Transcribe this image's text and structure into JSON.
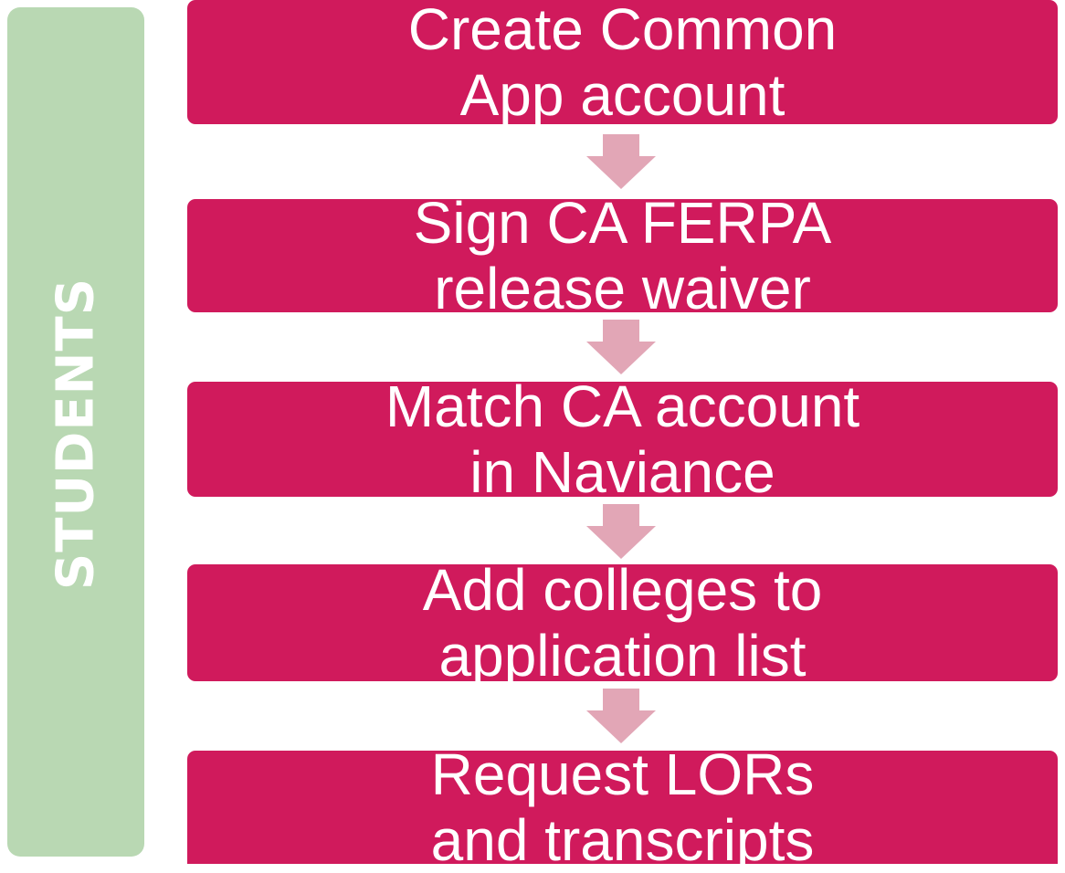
{
  "side_label": "STUDENTS",
  "steps": [
    "Create Common\nApp account",
    "Sign CA FERPA\nrelease waiver",
    "Match CA account\nin Naviance",
    "Add colleges to\napplication list",
    "Request LORs\nand transcripts"
  ],
  "colors": {
    "step_fill": "#d01a5c",
    "arrow_fill": "#e2a6b6",
    "side_band": "#b9d8b3"
  },
  "icons": {
    "connector": "down-arrow-icon"
  }
}
